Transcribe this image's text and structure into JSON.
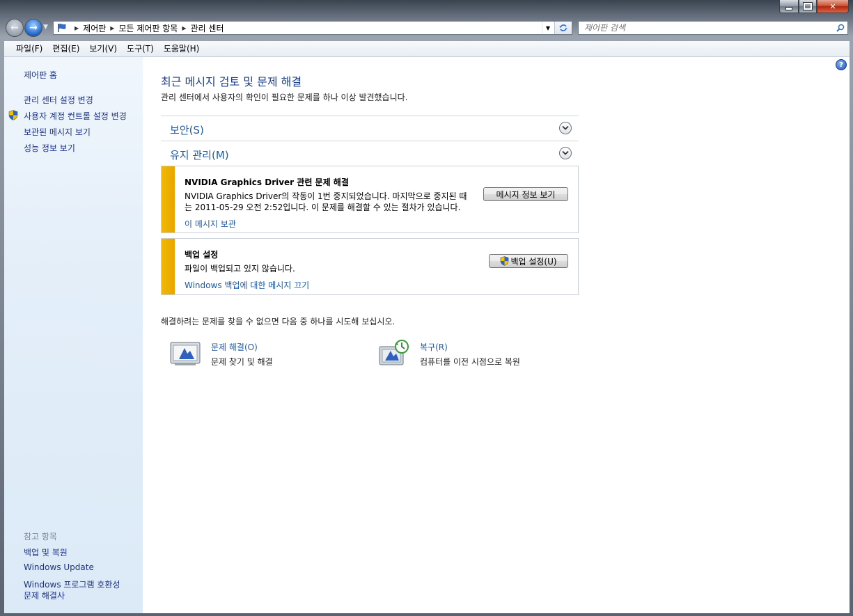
{
  "window": {
    "caption": {
      "minimize": "minimize-icon",
      "maximize": "maximize-icon",
      "close": "✕"
    }
  },
  "navbar": {
    "back_icon": "←",
    "forward_icon": "→",
    "breadcrumbs": [
      "제어판",
      "모든 제어판 항목",
      "관리 센터"
    ],
    "search_placeholder": "제어판 검색"
  },
  "menu": [
    "파일(F)",
    "편집(E)",
    "보기(V)",
    "도구(T)",
    "도움말(H)"
  ],
  "sidebar": {
    "home": "제어판 홈",
    "tasks": [
      "관리 센터 설정 변경",
      "사용자 계정 컨트롤 설정 변경",
      "보관된 메시지 보기",
      "성능 정보 보기"
    ],
    "see_also_title": "참고 항목",
    "see_also": [
      "백업 및 복원",
      "Windows Update",
      "Windows 프로그램 호환성",
      "문제 해결사"
    ]
  },
  "main": {
    "title": "최근 메시지 검토 및 문제 해결",
    "subtitle": "관리 센터에서 사용자의 확인이 필요한 문제를 하나 이상 발견했습니다.",
    "sections": [
      {
        "label": "보안(S)"
      },
      {
        "label": "유지 관리(M)"
      }
    ],
    "alerts": [
      {
        "title": "NVIDIA Graphics Driver 관련 문제 해결",
        "text_line1": "NVIDIA Graphics Driver의 작동이 1번 중지되었습니다. 마지막으로 중지된 때",
        "text_line2": "는 2011-05-29 오전 2:52입니다. 이 문제를 해결할 수 있는 절차가 있습니다.",
        "link": "이 메시지 보관",
        "button": "메시지 정보 보기"
      },
      {
        "title": "백업 설정",
        "text": "파일이 백업되고 있지 않습니다.",
        "link": "Windows 백업에 대한 메시지 끄기",
        "button": "백업 설정(U)"
      }
    ],
    "try_text": "해결하려는 문제를 찾을 수 없으면 다음 중 하나를 시도해 보십시오.",
    "tools": [
      {
        "title": "문제 해결(O)",
        "desc": "문제 찾기 및 해결"
      },
      {
        "title": "복구(R)",
        "desc": "컴퓨터를 이전 시점으로 복원"
      }
    ]
  },
  "colors": {
    "link": "#1e5aa8",
    "title": "#1e3e8c",
    "alert_bar": "#f2b800",
    "sidebar_bg": "#e3eef9"
  }
}
